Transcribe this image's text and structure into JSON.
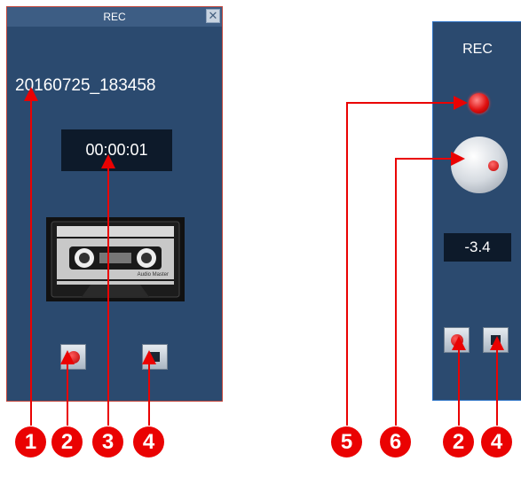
{
  "left_window": {
    "title": "REC",
    "close_glyph": "✕",
    "filename": "20160725_183458",
    "timer": "00:00:01",
    "cassette_label": "Audio Master"
  },
  "right_window": {
    "title": "REC",
    "level_value": "-3.4"
  },
  "callouts": [
    "1",
    "2",
    "3",
    "4",
    "5",
    "6",
    "2",
    "4"
  ],
  "colors": {
    "panel_bg": "#2b4a6f",
    "callout_red": "#ea0202",
    "display_bg": "#0d1a2a"
  },
  "icons": [
    "close-icon",
    "record-icon",
    "stop-icon",
    "cassette-icon",
    "level-knob-icon",
    "record-led-icon"
  ]
}
